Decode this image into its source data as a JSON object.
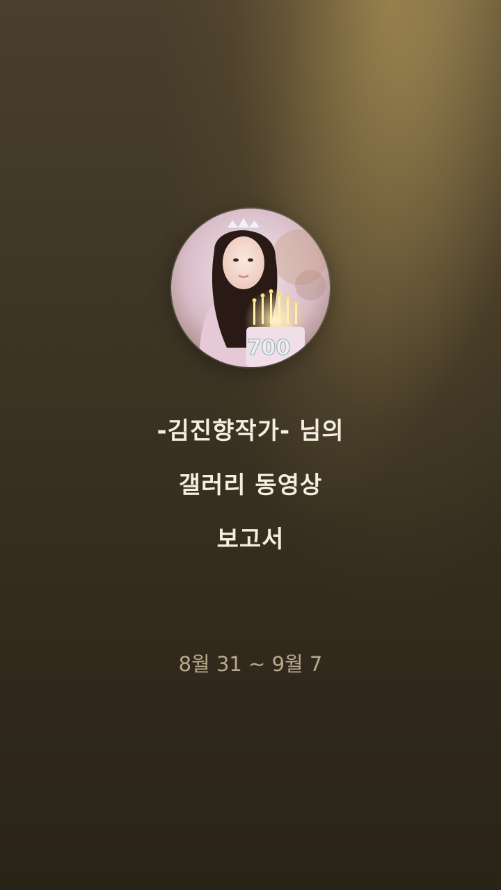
{
  "report": {
    "title_line1": "-김진향작가- 님의",
    "title_line2": "갤러리 동영상",
    "title_line3": "보고서",
    "date_range": "8월 31 ~ 9월 7"
  },
  "avatar": {
    "overlay_number": "700"
  },
  "colors": {
    "background_top": "#4a3f2c",
    "background_bottom": "#2a2318",
    "title_text": "#f3ede2",
    "date_text": "#b9a98c"
  }
}
